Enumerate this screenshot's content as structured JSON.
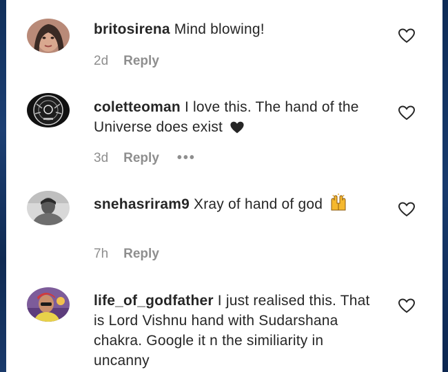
{
  "comments": [
    {
      "username": "britosirena",
      "text": "Mind blowing!",
      "time": "2d",
      "reply": "Reply"
    },
    {
      "username": "coletteoman",
      "text": "I love this. The hand of the Universe does exist",
      "time": "3d",
      "reply": "Reply",
      "more": "•••",
      "emoji": "black-heart"
    },
    {
      "username": "snehasriram9",
      "text": "Xray of hand of god",
      "time": "7h",
      "reply": "Reply",
      "emoji": "raised-hands"
    },
    {
      "username": "life_of_godfather",
      "text": "I just realised this. That is Lord Vishnu hand with Sudarshana chakra. Google it n the similiarity in uncanny"
    }
  ],
  "colors": {
    "text": "#262626",
    "meta": "#8e8e8e",
    "side_strip": "#1c3f73"
  }
}
